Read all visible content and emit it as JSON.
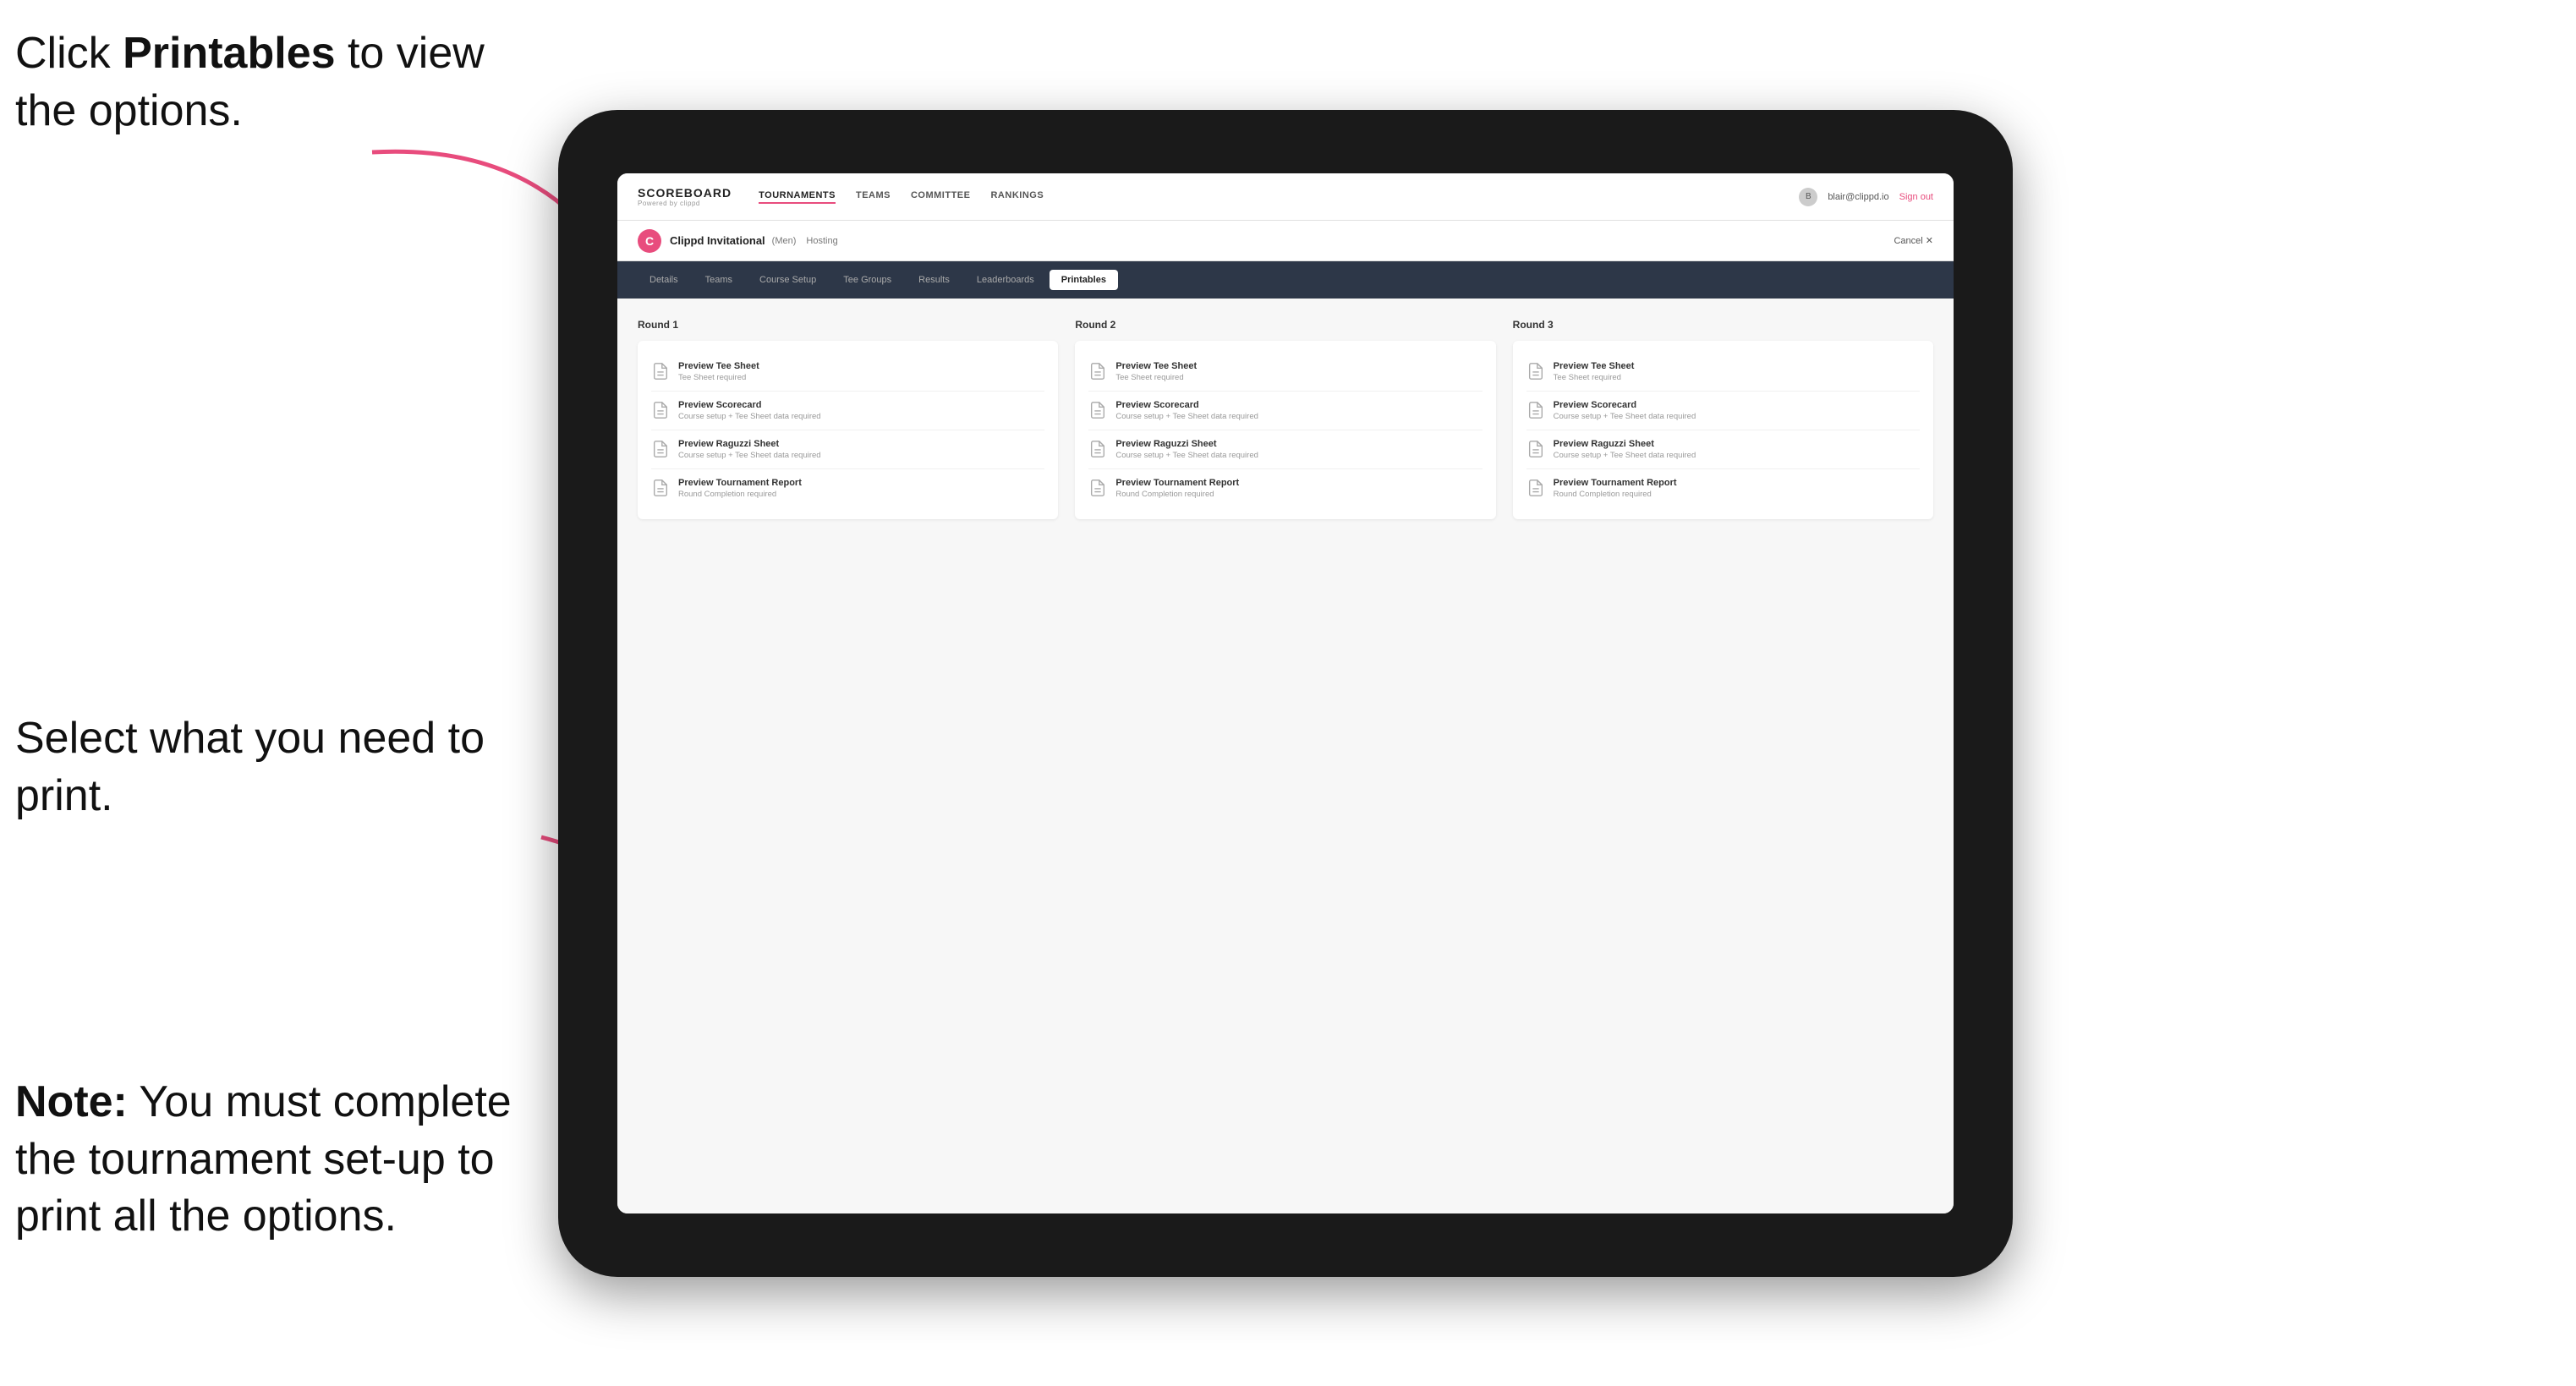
{
  "annotations": {
    "top": "Click Printables to view the options.",
    "top_bold": "Printables",
    "middle": "Select what you need to print.",
    "bottom_bold": "Note:",
    "bottom": " You must complete the tournament set-up to print all the options."
  },
  "topNav": {
    "logo_title": "SCOREBOARD",
    "logo_sub": "Powered by clippd",
    "links": [
      "TOURNAMENTS",
      "TEAMS",
      "COMMITTEE",
      "RANKINGS"
    ],
    "active_link": "TOURNAMENTS",
    "user_email": "blair@clippd.io",
    "sign_out": "Sign out"
  },
  "tournamentHeader": {
    "logo_letter": "C",
    "name": "Clippd Invitational",
    "tag": "(Men)",
    "hosting": "Hosting",
    "cancel": "Cancel ✕"
  },
  "subNav": {
    "tabs": [
      "Details",
      "Teams",
      "Course Setup",
      "Tee Groups",
      "Results",
      "Leaderboards",
      "Printables"
    ],
    "active_tab": "Printables"
  },
  "rounds": [
    {
      "title": "Round 1",
      "items": [
        {
          "name": "Preview Tee Sheet",
          "req": "Tee Sheet required"
        },
        {
          "name": "Preview Scorecard",
          "req": "Course setup + Tee Sheet data required"
        },
        {
          "name": "Preview Raguzzi Sheet",
          "req": "Course setup + Tee Sheet data required"
        },
        {
          "name": "Preview Tournament Report",
          "req": "Round Completion required"
        }
      ]
    },
    {
      "title": "Round 2",
      "items": [
        {
          "name": "Preview Tee Sheet",
          "req": "Tee Sheet required"
        },
        {
          "name": "Preview Scorecard",
          "req": "Course setup + Tee Sheet data required"
        },
        {
          "name": "Preview Raguzzi Sheet",
          "req": "Course setup + Tee Sheet data required"
        },
        {
          "name": "Preview Tournament Report",
          "req": "Round Completion required"
        }
      ]
    },
    {
      "title": "Round 3",
      "items": [
        {
          "name": "Preview Tee Sheet",
          "req": "Tee Sheet required"
        },
        {
          "name": "Preview Scorecard",
          "req": "Course setup + Tee Sheet data required"
        },
        {
          "name": "Preview Raguzzi Sheet",
          "req": "Course setup + Tee Sheet data required"
        },
        {
          "name": "Preview Tournament Report",
          "req": "Round Completion required"
        }
      ]
    }
  ]
}
